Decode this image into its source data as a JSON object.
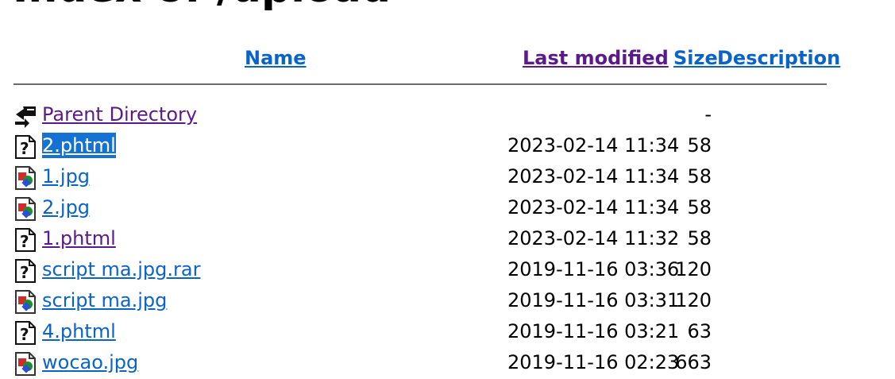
{
  "page": {
    "title": "Index of /upload"
  },
  "columns": {
    "name": "Name",
    "last_modified": "Last modified",
    "size": "Size",
    "description": "Description"
  },
  "parent": {
    "label": "Parent Directory",
    "size": "-",
    "icon": "back-arrow-icon"
  },
  "files": [
    {
      "name": "2.phtml",
      "modified": "2023-02-14 11:34",
      "size": "58",
      "icon": "unknown-file-icon",
      "selected": true
    },
    {
      "name": "1.jpg",
      "modified": "2023-02-14 11:34",
      "size": "58",
      "icon": "image-file-icon"
    },
    {
      "name": "2.jpg",
      "modified": "2023-02-14 11:34",
      "size": "58",
      "icon": "image-file-icon"
    },
    {
      "name": "1.phtml",
      "modified": "2023-02-14 11:32",
      "size": "58",
      "icon": "unknown-file-icon",
      "visited": true
    },
    {
      "name": "script ma.jpg.rar",
      "modified": "2019-11-16 03:36",
      "size": "120",
      "icon": "unknown-file-icon"
    },
    {
      "name": "script ma.jpg",
      "modified": "2019-11-16 03:31",
      "size": "120",
      "icon": "image-file-icon"
    },
    {
      "name": "4.phtml",
      "modified": "2019-11-16 03:21",
      "size": "63",
      "icon": "unknown-file-icon"
    },
    {
      "name": "wocao.jpg",
      "modified": "2019-11-16 02:23",
      "size": "663",
      "icon": "image-file-icon"
    }
  ],
  "colors": {
    "link": "#0a63c9",
    "visited": "#5b1a8b",
    "selection": "#1572d3",
    "rule": "#6b6b6b"
  }
}
